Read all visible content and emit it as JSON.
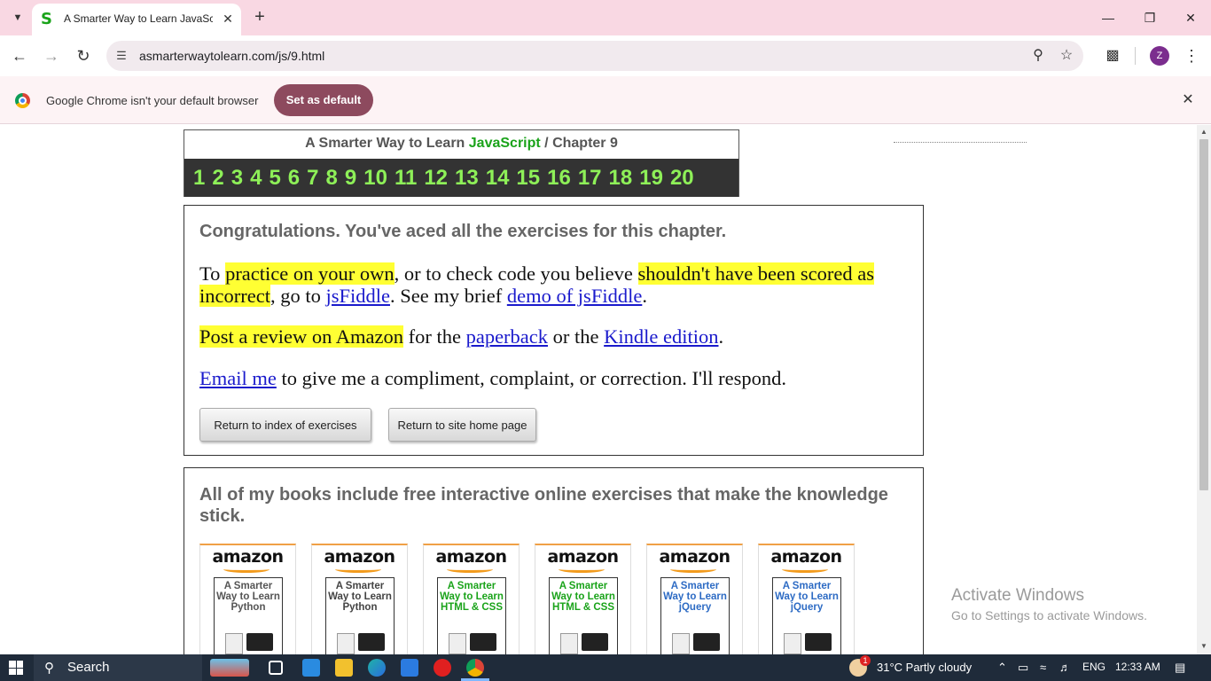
{
  "browser": {
    "tab_title": "A Smarter Way to Learn JavaSc",
    "tab_favicon": "S",
    "url": "asmarterwaytolearn.com/js/9.html",
    "avatar_letter": "Z",
    "accent": "#8d4a5e"
  },
  "infobar": {
    "message": "Google Chrome isn't your default browser",
    "button": "Set as default"
  },
  "chapter": {
    "title_prefix": "A Smarter Way to Learn",
    "title_js": "JavaScript",
    "title_suffix": "/  Chapter 9",
    "numbers": [
      "1",
      "2",
      "3",
      "4",
      "5",
      "6",
      "7",
      "8",
      "9",
      "10",
      "11",
      "12",
      "13",
      "14",
      "15",
      "16",
      "17",
      "18",
      "19",
      "20"
    ]
  },
  "congrats": {
    "heading": "Congratulations. You've aced all the exercises for this chapter.",
    "p1_a": "To ",
    "p1_hl1": "practice on your own",
    "p1_b": ", or to check code you believe ",
    "p1_hl2": "shouldn't have been scored as incorrect",
    "p1_c": ", go to ",
    "p1_link1": "jsFiddle",
    "p1_d": ". See my brief ",
    "p1_link2": "demo of jsFiddle",
    "p1_e": ".",
    "p2_hl": "Post a review on Amazon",
    "p2_a": " for the ",
    "p2_link1": "paperback",
    "p2_b": " or the ",
    "p2_link2": "Kindle edition",
    "p2_c": ".",
    "p3_link": "Email me",
    "p3_a": " to give me a compliment, complaint, or correction. I'll respond.",
    "btn_index": "Return to index of exercises",
    "btn_home": "Return to site home page"
  },
  "books": {
    "heading": "All of my books include free interactive online exercises that make the knowledge stick.",
    "store": "amazon",
    "items": [
      {
        "title": "A Smarter Way to Learn Python",
        "color": "#555555"
      },
      {
        "title": "A Smarter Way to Learn Python",
        "color": "#444444"
      },
      {
        "title": "A Smarter Way to Learn HTML & CSS",
        "color": "#1aa31a"
      },
      {
        "title": "A Smarter Way to Learn HTML & CSS",
        "color": "#1aa31a"
      },
      {
        "title": "A Smarter Way to Learn jQuery",
        "color": "#2d6bc4"
      },
      {
        "title": "A Smarter Way to Learn jQuery",
        "color": "#2d6bc4"
      }
    ]
  },
  "watermark": {
    "line1": "Activate Windows",
    "line2": "Go to Settings to activate Windows."
  },
  "taskbar": {
    "search": "Search",
    "weather": "31°C  Partly cloudy",
    "lang": "ENG",
    "time": "12:33 AM",
    "notification_badge": "1"
  }
}
